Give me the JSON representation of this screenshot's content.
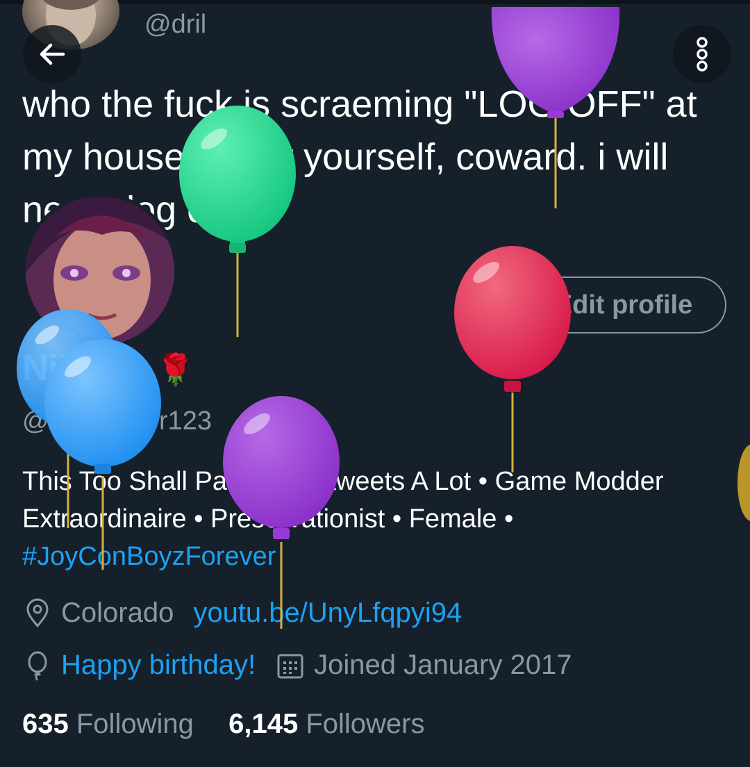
{
  "header": {
    "handle": "@dril",
    "back_label": "Back",
    "menu_label": "More options"
  },
  "tweet": {
    "text": "who the fuck is scraeming \"LOG OFF\" at my house. show yourself, coward. i will never log off"
  },
  "profile": {
    "display_name": "Nikki",
    "trademark": "TM",
    "emoji": "🌹",
    "handle": "@NWPlayer123",
    "bio": "This Too Shall Pass • (Re)tweets A Lot • Game Modder Extraordinaire • Preservationist • Female •",
    "hashtag": "#JoyConBoyzForever",
    "location": "Colorado",
    "website": "youtu.be/UnyLfqpyi94",
    "birthday": "Happy birthday!",
    "joined": "Joined January 2017",
    "edit_profile_label": "Edit profile"
  },
  "stats": {
    "following_count": "635",
    "following_label": "Following",
    "followers_count": "6,145",
    "followers_label": "Followers"
  },
  "icons": {
    "back": "arrow-left-icon",
    "menu": "more-vertical-icon",
    "location": "location-pin-icon",
    "birthday": "balloon-icon",
    "joined": "calendar-icon"
  },
  "colors": {
    "background": "#15202b",
    "accent": "#1da1f2",
    "muted": "#8899a6",
    "text": "#ffffff"
  }
}
